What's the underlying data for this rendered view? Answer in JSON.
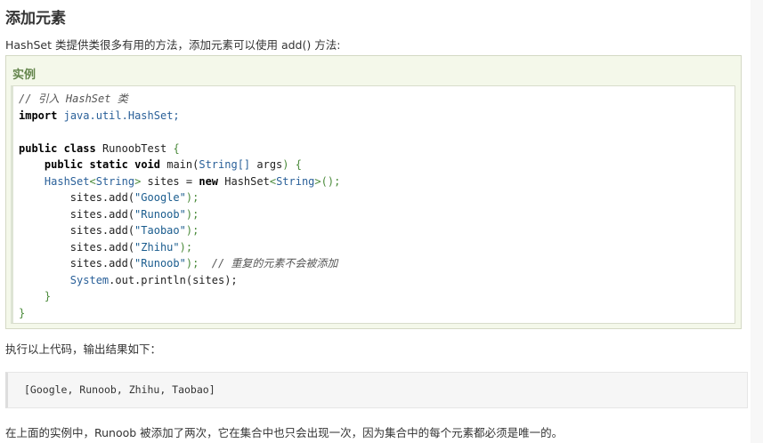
{
  "title": "添加元素",
  "intro": "HashSet 类提供类很多有用的方法，添加元素可以使用 add() 方法:",
  "example": {
    "label": "实例",
    "code": {
      "l1_comment": "// 引入 HashSet 类",
      "l2_import": "import",
      "l2_pkg": "java.util.HashSet;",
      "l4_public": "public",
      "l4_class": "class",
      "l4_name": "RunoobTest",
      "l4_open": "{",
      "l5_public": "public",
      "l5_static": "static",
      "l5_void": "void",
      "l5_method": "main(",
      "l5_type": "String[]",
      "l5_args": " args",
      "l5_close": ") {",
      "l6_type": "HashSet",
      "l6_lt": "<",
      "l6_generic": "String",
      "l6_gt": ">",
      "l6_var": " sites = ",
      "l6_new": "new",
      "l6_ctor": " HashSet",
      "l6_ctor_lt": "<",
      "l6_ctor_generic": "String",
      "l6_ctor_tail": ">();",
      "add_call": "sites.add(",
      "add_values": [
        "\"Google\"",
        "\"Runoob\"",
        "\"Taobao\"",
        "\"Zhihu\"",
        "\"Runoob\""
      ],
      "add_close": ");",
      "dup_comment": "// 重复的元素不会被添加",
      "println_obj": "System",
      "println_rest": ".out.println(sites);",
      "inner_close": "}",
      "outer_close": "}"
    }
  },
  "output_label": "执行以上代码，输出结果如下：",
  "output": "[Google, Runoob, Zhihu, Taobao]",
  "footer": "在上面的实例中，Runoob 被添加了两次，它在集合中也只会出现一次，因为集合中的每个元素都必须是唯一的。",
  "colors": {
    "example_bg": "#f4f8ea",
    "example_label": "#64854c",
    "string": "#1a5c8e",
    "punctuation": "#4a8a3a"
  }
}
